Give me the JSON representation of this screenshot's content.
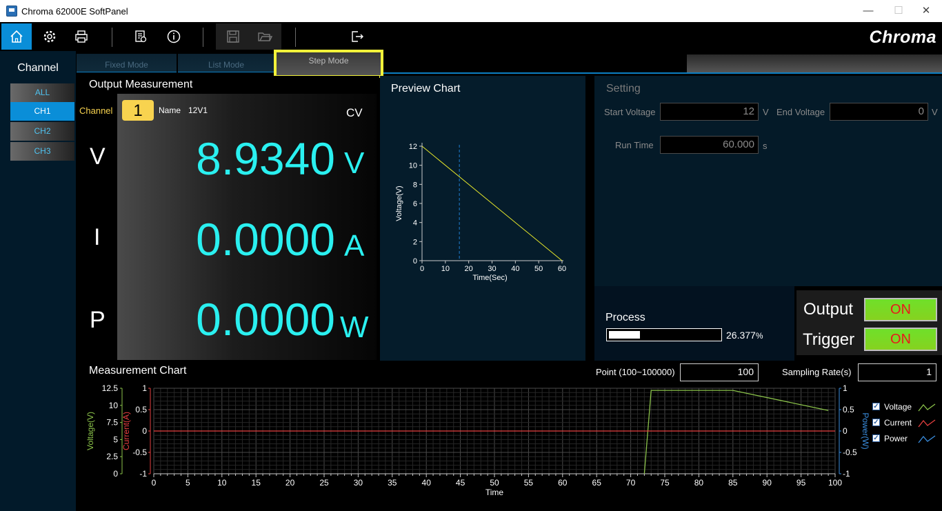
{
  "window": {
    "title": "Chroma 62000E SoftPanel"
  },
  "toolbar": {
    "items": [
      "home",
      "settings",
      "print",
      "report",
      "info",
      "save",
      "open",
      "exit"
    ],
    "logo": "Chroma"
  },
  "channel_panel": {
    "title": "Channel",
    "items": [
      "ALL",
      "CH1",
      "CH2",
      "CH3"
    ],
    "selected": "CH1"
  },
  "mode_tabs": {
    "fixed": "Fixed Mode",
    "list": "List Mode",
    "step": "Step Mode",
    "selected": "Step Mode"
  },
  "output_measurement": {
    "title": "Output Measurement",
    "channel_label": "Channel",
    "channel_number": "1",
    "name_label": "Name",
    "name_value": "12V1",
    "mode": "CV",
    "voltage": {
      "letter": "V",
      "value": "8.9340",
      "unit": "V"
    },
    "current": {
      "letter": "I",
      "value": "0.0000",
      "unit": "A"
    },
    "power": {
      "letter": "P",
      "value": "0.0000",
      "unit": "W"
    }
  },
  "preview_chart": {
    "title": "Preview Chart",
    "chart_data": {
      "type": "line",
      "xlabel": "Time(Sec)",
      "ylabel": "Voltage(V)",
      "x_ticks": [
        "0",
        "10",
        "20",
        "30",
        "40",
        "50",
        "60"
      ],
      "y_ticks": [
        "0",
        "2",
        "4",
        "6",
        "8",
        "10",
        "12"
      ],
      "xlim": [
        0,
        60
      ],
      "ylim": [
        0,
        12
      ],
      "series": [
        {
          "x": [
            0,
            60
          ],
          "y": [
            12,
            0
          ],
          "color": "#e8e82a"
        }
      ],
      "marker_x": 16,
      "marker_color": "#1e7fd0"
    }
  },
  "setting": {
    "title": "Setting",
    "start_voltage_label": "Start Voltage",
    "start_voltage": "12",
    "start_voltage_unit": "V",
    "end_voltage_label": "End Voltage",
    "end_voltage": "0",
    "end_voltage_unit": "V",
    "run_time_label": "Run Time",
    "run_time": "60.000",
    "run_time_unit": "s"
  },
  "process": {
    "title": "Process",
    "percent_text": "26.377",
    "percent_unit": "%",
    "fraction": 0.28
  },
  "output_trigger": {
    "output_label": "Output",
    "output_state": "ON",
    "trigger_label": "Trigger",
    "trigger_state": "ON"
  },
  "measurement_chart": {
    "title": "Measurement Chart",
    "point_label": "Point (100~100000)",
    "point_value": "100",
    "sampling_label": "Sampling Rate(s)",
    "sampling_value": "1",
    "legend": [
      {
        "name": "Voltage",
        "color": "#8bc34a"
      },
      {
        "name": "Current",
        "color": "#e84040"
      },
      {
        "name": "Power",
        "color": "#3a8ee0"
      }
    ],
    "chart_data": {
      "type": "line",
      "xlabel": "Time",
      "ylabel_left_1": "Voltage(V)",
      "ylabel_left_2": "Current(A)",
      "ylabel_right": "Power(W)",
      "x_ticks": [
        "0",
        "5",
        "10",
        "15",
        "20",
        "25",
        "30",
        "35",
        "40",
        "45",
        "50",
        "55",
        "60",
        "65",
        "70",
        "75",
        "80",
        "85",
        "90",
        "95",
        "100"
      ],
      "voltage_ticks": [
        "0",
        "2.5",
        "5",
        "7.5",
        "10",
        "12.5"
      ],
      "current_ticks": [
        "-1",
        "-0.5",
        "0",
        "0.5",
        "1"
      ],
      "power_ticks": [
        "-1",
        "-0.5",
        "0",
        "0.5",
        "1"
      ],
      "xlim": [
        0,
        100
      ],
      "current_ylim": [
        -1,
        1
      ],
      "series": [
        {
          "name": "Voltage",
          "x": [
            72,
            73,
            85,
            99
          ],
          "y": [
            -1,
            0.95,
            0.95,
            0.48
          ],
          "color": "#8bc34a"
        },
        {
          "name": "Current",
          "x": [
            0,
            100
          ],
          "y": [
            0,
            0
          ],
          "color": "#e84040"
        }
      ]
    }
  }
}
